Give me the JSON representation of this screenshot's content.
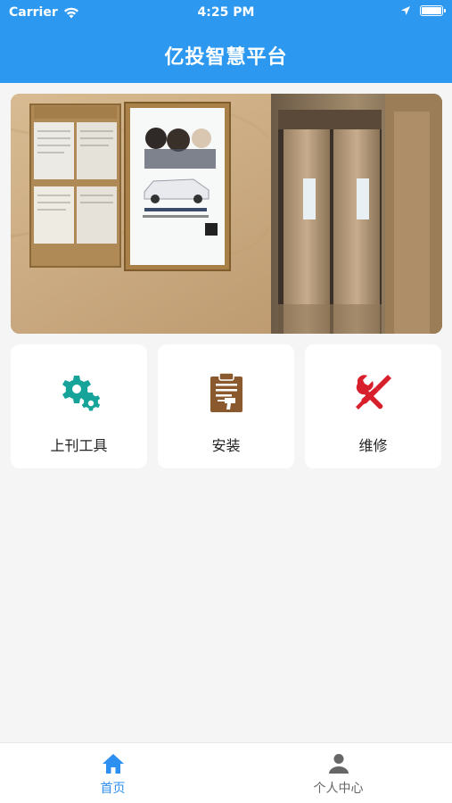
{
  "status_bar": {
    "carrier": "Carrier",
    "time": "4:25 PM",
    "battery_level": 1.0
  },
  "header": {
    "title": "亿投智慧平台",
    "background_color": "#2d98ef"
  },
  "banner": {
    "image_description_icon": "elevator-lobby-ad-photo"
  },
  "feature_cards": [
    {
      "label": "上刊工具",
      "icon": "gears-icon",
      "color": "#16a39a"
    },
    {
      "label": "安装",
      "icon": "clipboard-drill-icon",
      "color": "#8a5a2e"
    },
    {
      "label": "维修",
      "icon": "tools-icon",
      "color": "#d8202d"
    }
  ],
  "tab_bar": {
    "items": [
      {
        "label": "首页",
        "icon": "home-icon",
        "active": true
      },
      {
        "label": "个人中心",
        "icon": "person-icon",
        "active": false
      }
    ],
    "active_color": "#2d8ff0",
    "inactive_color": "#666666"
  }
}
